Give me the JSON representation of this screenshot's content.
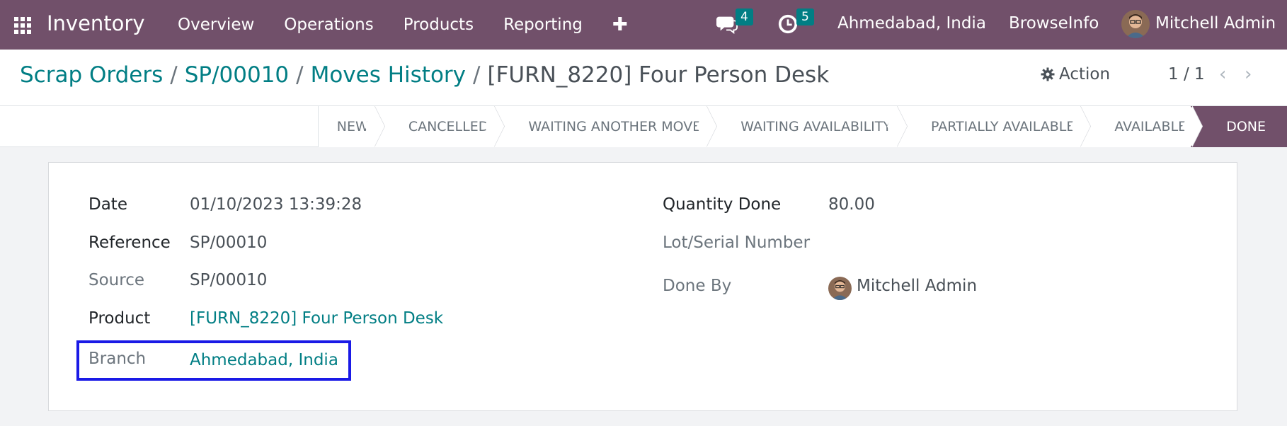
{
  "app": {
    "name": "Inventory"
  },
  "menu": [
    "Overview",
    "Operations",
    "Products",
    "Reporting"
  ],
  "systray": {
    "messages_count": "4",
    "activities_count": "5",
    "company": "Ahmedabad, India",
    "browseinfo": "BrowseInfo",
    "user": "Mitchell Admin"
  },
  "breadcrumb": {
    "items": [
      "Scrap Orders",
      "SP/00010",
      "Moves History"
    ],
    "separator": "/",
    "current": "[FURN_8220] Four Person Desk"
  },
  "control": {
    "action_label": "Action",
    "pager": "1 / 1"
  },
  "status": {
    "steps": [
      "NEW",
      "CANCELLED",
      "WAITING ANOTHER MOVE",
      "WAITING AVAILABILITY",
      "PARTIALLY AVAILABLE",
      "AVAILABLE",
      "DONE"
    ],
    "active": "DONE"
  },
  "form": {
    "date_label": "Date",
    "date_value": "01/10/2023 13:39:28",
    "reference_label": "Reference",
    "reference_value": "SP/00010",
    "source_label": "Source",
    "source_value": "SP/00010",
    "product_label": "Product",
    "product_value": "[FURN_8220] Four Person Desk",
    "branch_label": "Branch",
    "branch_value": "Ahmedabad, India",
    "qty_label": "Quantity Done",
    "qty_value": "80.00",
    "lot_label": "Lot/Serial Number",
    "lot_value": "",
    "doneby_label": "Done By",
    "doneby_value": "Mitchell Admin"
  },
  "colors": {
    "navbar": "#71506a",
    "link": "#017e84",
    "highlight": "#1a1ae6"
  }
}
